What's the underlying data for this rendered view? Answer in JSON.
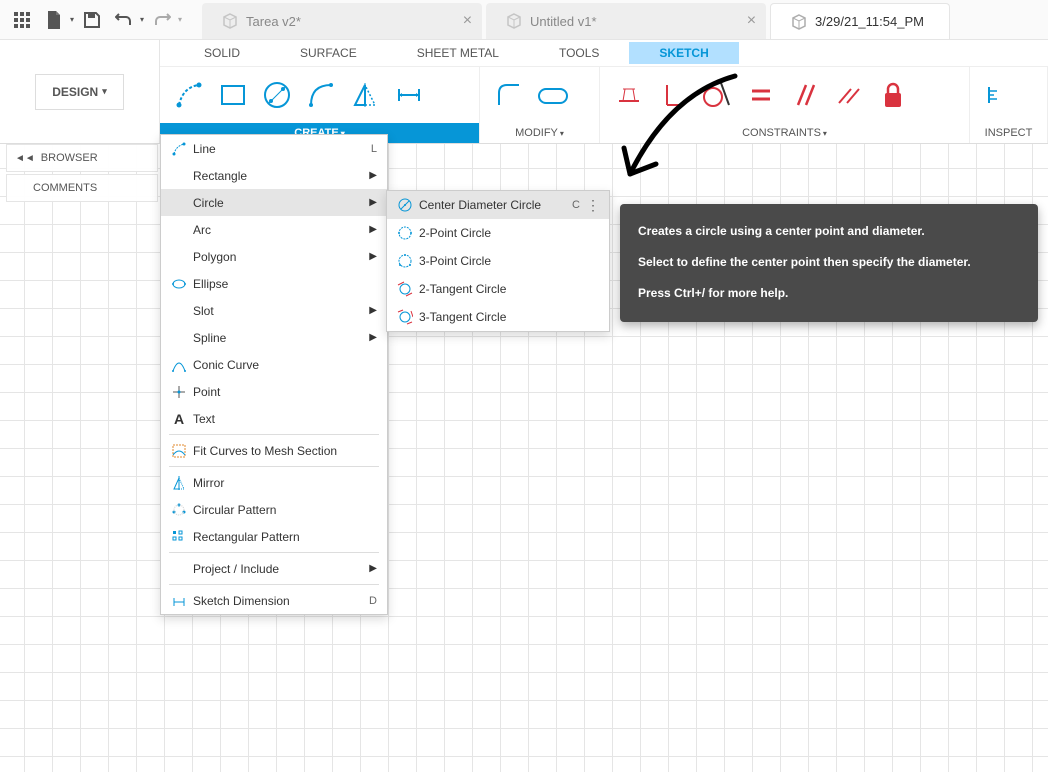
{
  "quick_access": {
    "grid_icon": "grid",
    "file_icon": "file",
    "save_icon": "save",
    "undo_icon": "undo",
    "redo_icon": "redo"
  },
  "tabs": [
    {
      "label": "Tarea v2*",
      "active": false
    },
    {
      "label": "Untitled v1*",
      "active": false
    },
    {
      "label": "3/29/21_11:54_PM",
      "active": true
    }
  ],
  "workspace": {
    "label": "DESIGN"
  },
  "ribbon_tabs": [
    {
      "label": "SOLID"
    },
    {
      "label": "SURFACE"
    },
    {
      "label": "SHEET METAL"
    },
    {
      "label": "TOOLS"
    },
    {
      "label": "SKETCH",
      "active": true
    }
  ],
  "ribbon_groups": {
    "create": {
      "label": "CREATE"
    },
    "modify": {
      "label": "MODIFY"
    },
    "constraints": {
      "label": "CONSTRAINTS"
    },
    "inspect": {
      "label": "INSPECT"
    }
  },
  "left_panels": {
    "browser": "BROWSER",
    "comments": "COMMENTS"
  },
  "create_menu": {
    "items": [
      {
        "label": "Line",
        "shortcut": "L",
        "icon": "line-icon"
      },
      {
        "label": "Rectangle",
        "submenu": true
      },
      {
        "label": "Circle",
        "submenu": true,
        "highlighted": true
      },
      {
        "label": "Arc",
        "submenu": true
      },
      {
        "label": "Polygon",
        "submenu": true
      },
      {
        "label": "Ellipse",
        "icon": "ellipse-icon"
      },
      {
        "label": "Slot",
        "submenu": true
      },
      {
        "label": "Spline",
        "submenu": true
      },
      {
        "label": "Conic Curve",
        "icon": "conic-icon"
      },
      {
        "label": "Point",
        "icon": "point-icon"
      },
      {
        "label": "Text",
        "icon": "text-icon"
      },
      {
        "label": "Fit Curves to Mesh Section",
        "icon": "fitcurve-icon"
      },
      {
        "label": "Mirror",
        "icon": "mirror-icon"
      },
      {
        "label": "Circular Pattern",
        "icon": "circ-pattern-icon"
      },
      {
        "label": "Rectangular Pattern",
        "icon": "rect-pattern-icon"
      },
      {
        "label": "Project / Include",
        "submenu": true
      },
      {
        "label": "Sketch Dimension",
        "shortcut": "D",
        "icon": "dimension-icon"
      }
    ]
  },
  "circle_submenu": {
    "items": [
      {
        "label": "Center Diameter Circle",
        "shortcut": "C",
        "highlighted": true
      },
      {
        "label": "2-Point Circle"
      },
      {
        "label": "3-Point Circle"
      },
      {
        "label": "2-Tangent Circle"
      },
      {
        "label": "3-Tangent Circle"
      }
    ]
  },
  "tooltip": {
    "line1": "Creates a circle using a center point and diameter.",
    "line2": "Select to define the center point then specify the diameter.",
    "line3": "Press Ctrl+/ for more help."
  }
}
